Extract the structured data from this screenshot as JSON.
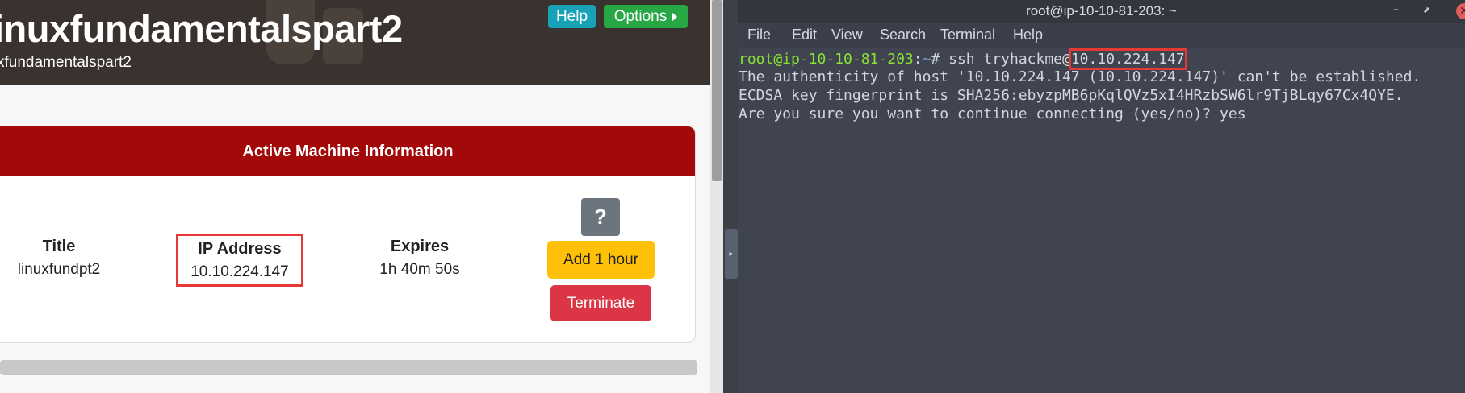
{
  "browser": {
    "room_title": "inuxfundamentalspart2",
    "room_subtitle": "xfundamentalspart2",
    "help_label": "Help",
    "options_label": "Options",
    "card": {
      "header": "Active Machine Information",
      "title_label": "Title",
      "title_value": "linuxfundpt2",
      "ip_label": "IP Address",
      "ip_value": "10.10.224.147",
      "expires_label": "Expires",
      "expires_value": "1h 40m 50s",
      "help_glyph": "?",
      "add_hour_label": "Add 1 hour",
      "terminate_label": "Terminate"
    }
  },
  "terminal": {
    "window_title": "root@ip-10-10-81-203: ~",
    "menu": [
      "File",
      "Edit",
      "View",
      "Search",
      "Terminal",
      "Help"
    ],
    "prompt_user": "root@ip-10-10-81-203",
    "prompt_sep": ":",
    "prompt_path": "~",
    "prompt_symbol": "# ",
    "command_prefix": "ssh tryhackme@",
    "command_host": "10.10.224.147",
    "output": [
      "The authenticity of host '10.10.224.147 (10.10.224.147)' can't be established.",
      "ECDSA key fingerprint is SHA256:ebyzpMB6pKqlQVz5xI4HRzbSW6lr9TjBLqy67Cx4QYE.",
      "Are you sure you want to continue connecting (yes/no)? yes"
    ]
  },
  "colors": {
    "card_header": "#a30909",
    "help_button": "#17a2b8",
    "options_button": "#28a745",
    "add_hour_button": "#ffc107",
    "terminate_button": "#dc3545",
    "highlight_box": "#e53935",
    "prompt_user": "#8ae234",
    "prompt_path": "#729fcf"
  },
  "icons": {
    "options_caret": "caret-right-icon",
    "close": "close-icon",
    "minimize": "minimize-icon",
    "maximize": "maximize-icon",
    "splitter": "drag-handle-icon"
  }
}
